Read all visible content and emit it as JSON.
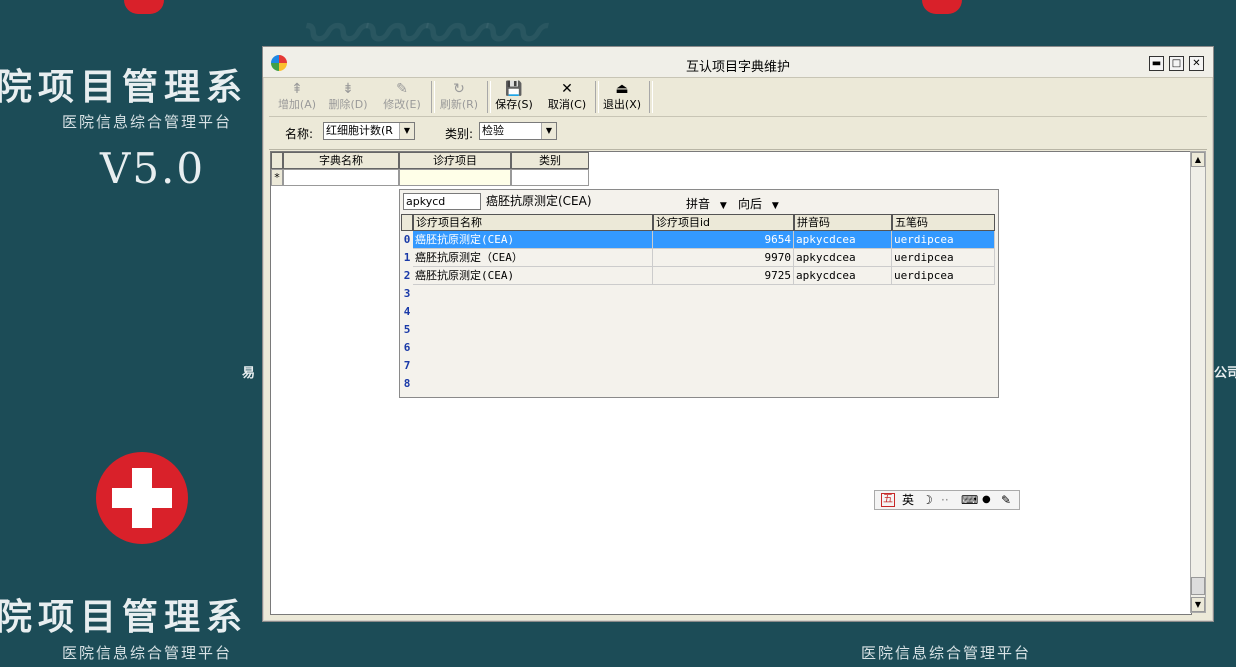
{
  "wallpaper": {
    "title": "院项目管理系",
    "subtitle": "医院信息综合管理平台",
    "version": "V5.0",
    "side_left": "易",
    "side_right": "公司",
    "bottom_title": "院项目管理系",
    "bottom_subtitle": "医院信息综合管理平台",
    "bottom_subtitle_right": "医院信息综合管理平台"
  },
  "window": {
    "title": "互认项目字典维护",
    "buttons": {
      "minimize": "▬",
      "maximize": "□",
      "close": "✕"
    }
  },
  "toolbar": {
    "add": {
      "icon": "⇞",
      "label": "增加(A)"
    },
    "delete": {
      "icon": "⇟",
      "label": "删除(D)"
    },
    "edit": {
      "icon": "✎",
      "label": "修改(E)"
    },
    "refresh": {
      "icon": "↻",
      "label": "刷新(R)"
    },
    "save": {
      "icon": "💾",
      "label": "保存(S)"
    },
    "cancel": {
      "icon": "✕",
      "label": "取消(C)"
    },
    "exit": {
      "icon": "⏏",
      "label": "退出(X)"
    }
  },
  "filter": {
    "name_label": "名称:",
    "name_value": "红细胞计数(R",
    "category_label": "类别:",
    "category_value": "检验"
  },
  "grid": {
    "columns": [
      "字典名称",
      "诊疗项目",
      "类别"
    ],
    "new_row_marker": "*"
  },
  "popup": {
    "search_value": "apkycd",
    "match_text": "癌胚抗原测定(CEA)",
    "mode_option": "拼音",
    "direction_option": "向后",
    "columns": [
      "诊疗项目名称",
      "诊疗项目id",
      "拼音码",
      "五笔码"
    ],
    "row_numbers": [
      "0",
      "1",
      "2",
      "3",
      "4",
      "5",
      "6",
      "7",
      "8"
    ],
    "rows": [
      {
        "name": "癌胚抗原测定(CEA)",
        "id": "9654",
        "pinyin": "apkycdcea",
        "wubi": "uerdipcea"
      },
      {
        "name": "癌胚抗原测定（CEA）",
        "id": "9970",
        "pinyin": "apkycdcea",
        "wubi": "uerdipcea"
      },
      {
        "name": "癌胚抗原测定(CEA)",
        "id": "9725",
        "pinyin": "apkycdcea",
        "wubi": "uerdipcea"
      }
    ],
    "selected_row": 0
  },
  "ime": {
    "wubi_label": "五",
    "lang_label": "英",
    "moon": "☽",
    "dots": "··",
    "keyboard": "⌨",
    "user": "●",
    "wrench": "✎"
  },
  "colors": {
    "desktop": "#1c4c57",
    "selection": "#3399ff",
    "logo_red": "#d9212a"
  }
}
